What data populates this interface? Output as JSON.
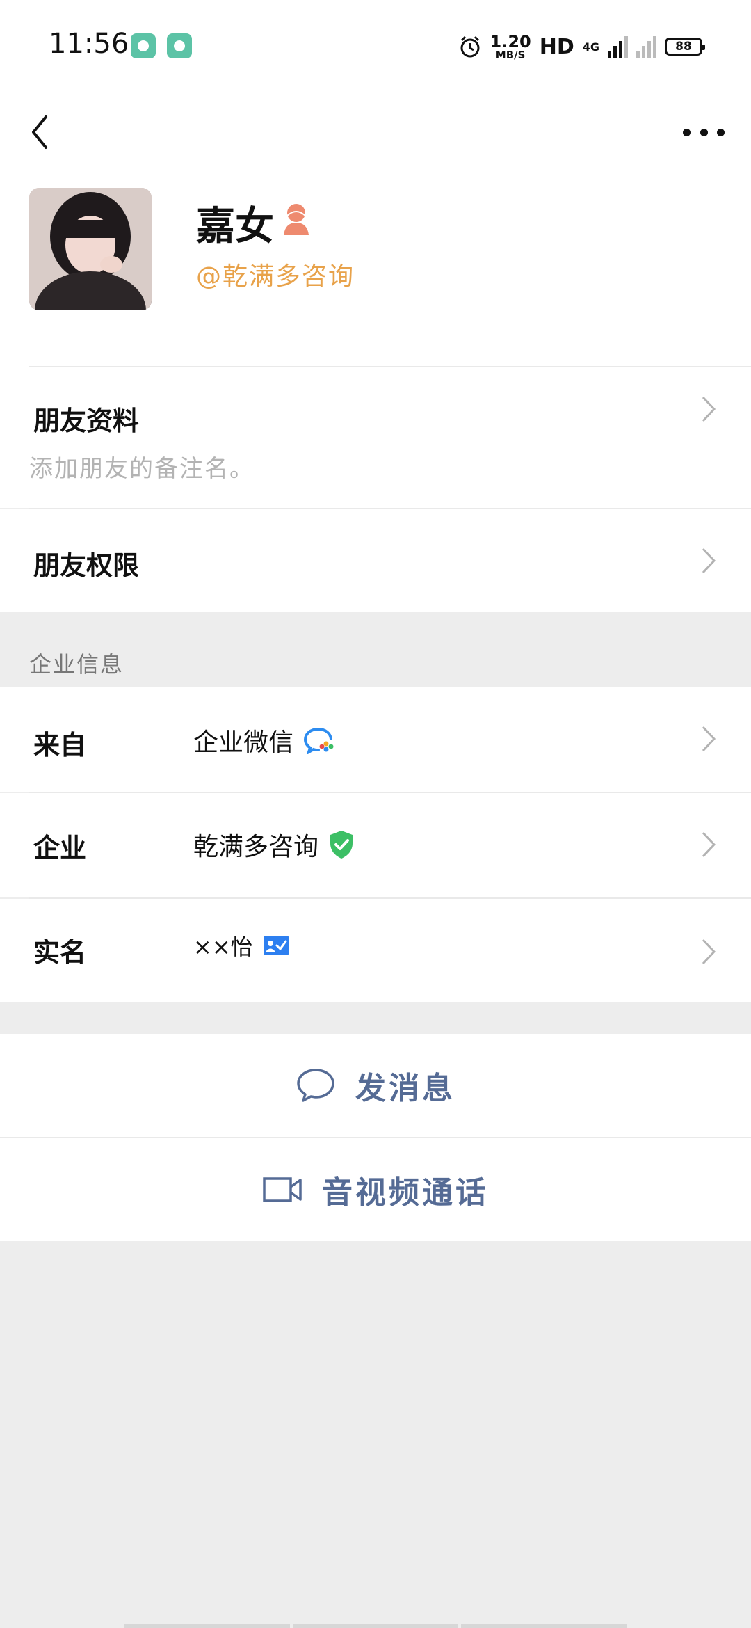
{
  "status_bar": {
    "time": "11:56",
    "net_speed": "1.20",
    "net_unit": "MB/S",
    "hd": "HD",
    "network": "4G",
    "battery": "88"
  },
  "profile": {
    "name": "嘉女",
    "company_tag": "@乾满多咨询"
  },
  "friend_profile": {
    "label": "朋友资料",
    "hint": "添加朋友的备注名。"
  },
  "friend_permission": {
    "label": "朋友权限"
  },
  "enterprise_section": {
    "title": "企业信息",
    "rows": [
      {
        "label": "来自",
        "value": "企业微信"
      },
      {
        "label": "企业",
        "value": "乾满多咨询"
      },
      {
        "label": "实名",
        "value": "××怡"
      }
    ]
  },
  "actions": {
    "message": "发消息",
    "call": "音视频通话"
  },
  "colors": {
    "accent_orange": "#e8a24a",
    "action_blue": "#556b95",
    "verified_green": "#3cbf65"
  }
}
